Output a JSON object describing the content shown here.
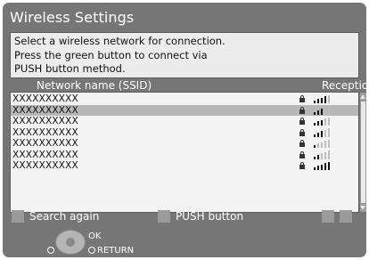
{
  "dialog": {
    "title": "Wireless Settings",
    "message_lines": [
      "Select a wireless network for connection.",
      "Press the green button to connect via",
      "PUSH button method."
    ]
  },
  "list": {
    "column_ssid": "Network name (SSID)",
    "column_reception": "Reception",
    "selected_index": 1,
    "rows": [
      {
        "ssid": "XXXXXXXXXX",
        "secured": true,
        "reception_level": 4
      },
      {
        "ssid": "XXXXXXXXXX",
        "secured": true,
        "reception_level": 3
      },
      {
        "ssid": "XXXXXXXXXX",
        "secured": true,
        "reception_level": 3
      },
      {
        "ssid": "XXXXXXXXXX",
        "secured": true,
        "reception_level": 3
      },
      {
        "ssid": "XXXXXXXXXX",
        "secured": true,
        "reception_level": 1
      },
      {
        "ssid": "XXXXXXXXXX",
        "secured": true,
        "reception_level": 2
      },
      {
        "ssid": "XXXXXXXXXX",
        "secured": true,
        "reception_level": 5
      }
    ]
  },
  "buttons": {
    "search_again": "Search again",
    "push_button": "PUSH button"
  },
  "nav_hints": {
    "ok": "OK",
    "return": "RETURN"
  },
  "colors": {
    "panel": "#767676",
    "list_bg": "#f3f3f3",
    "selected_row": "#b7b7b7",
    "bar_active": "#111111",
    "bar_inactive": "#bdbdbd"
  },
  "icons": [
    "lock-icon",
    "signal-bars-icon",
    "scroll-up-arrow-icon",
    "scroll-down-arrow-icon",
    "dpad-icon",
    "return-circle-icon"
  ]
}
